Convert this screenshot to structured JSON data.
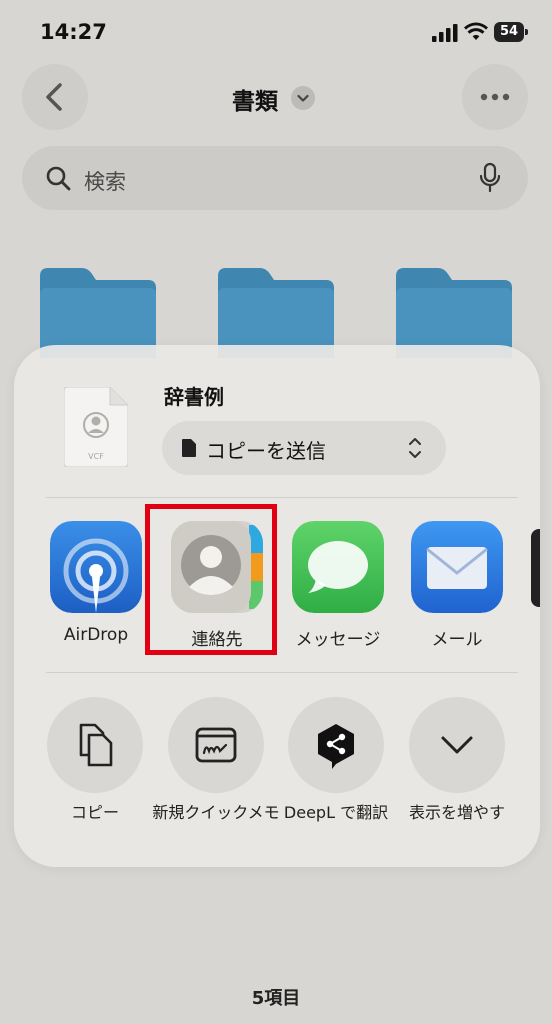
{
  "status_bar": {
    "time": "14:27",
    "battery": "54"
  },
  "nav": {
    "title": "書類"
  },
  "search": {
    "placeholder": "検索"
  },
  "share_sheet": {
    "file_name": "辞書例",
    "file_type": "VCF",
    "send_option": "コピーを送信",
    "apps": [
      {
        "label": "AirDrop"
      },
      {
        "label": "連絡先"
      },
      {
        "label": "メッセージ"
      },
      {
        "label": "メール"
      }
    ],
    "actions": [
      {
        "label": "コピー"
      },
      {
        "label": "新規クイックメモ"
      },
      {
        "label": "DeepL で翻訳"
      },
      {
        "label": "表示を増やす"
      }
    ]
  },
  "footer": {
    "item_count": "5項目"
  },
  "colors": {
    "highlight": "#e00012",
    "folder": "#4a90b8",
    "messages_green": "#34c759",
    "mail_blue": "#2f7fe0"
  }
}
